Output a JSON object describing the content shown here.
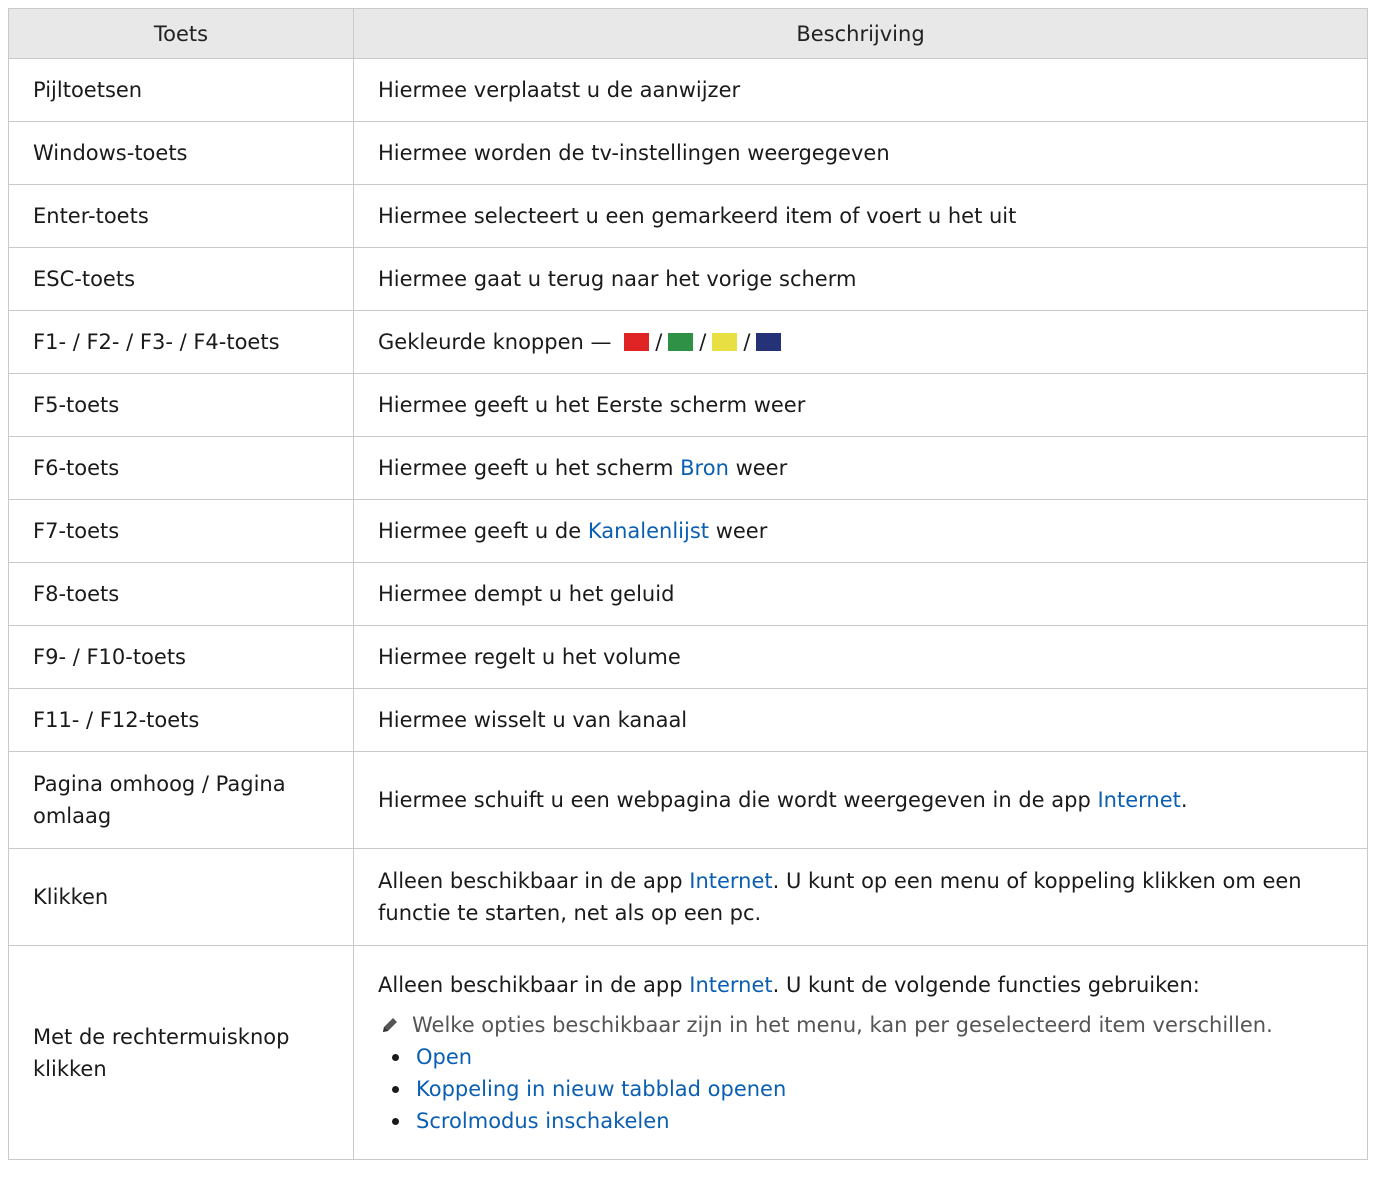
{
  "header": {
    "key": "Toets",
    "description": "Beschrijving"
  },
  "rows": {
    "r0": {
      "key": "Pijltoetsen",
      "desc": "Hiermee verplaatst u de aanwijzer"
    },
    "r1": {
      "key": "Windows-toets",
      "desc": "Hiermee worden de tv-instellingen weergegeven"
    },
    "r2": {
      "key": "Enter-toets",
      "desc": "Hiermee selecteert u een gemarkeerd item of voert u het uit"
    },
    "r3": {
      "key": "ESC-toets",
      "desc": "Hiermee gaat u terug naar het vorige scherm"
    },
    "r4": {
      "key": "F1- / F2- / F3- / F4-toets",
      "desc": "Gekleurde knoppen —",
      "separator": "/",
      "colors": [
        "#e02325",
        "#2e9146",
        "#e8df43",
        "#263278"
      ]
    },
    "r5": {
      "key": "F5-toets",
      "desc": "Hiermee geeft u het Eerste scherm weer"
    },
    "r6": {
      "key": "F6-toets",
      "desc_pre": "Hiermee geeft u het scherm",
      "link": "Bron",
      "desc_post": "weer"
    },
    "r7": {
      "key": "F7-toets",
      "desc_pre": "Hiermee geeft u de",
      "link": "Kanalenlijst",
      "desc_post": "weer"
    },
    "r8": {
      "key": "F8-toets",
      "desc": "Hiermee dempt u het geluid"
    },
    "r9": {
      "key": "F9- / F10-toets",
      "desc": "Hiermee regelt u het volume"
    },
    "r10": {
      "key": "F11- / F12-toets",
      "desc": "Hiermee wisselt u van kanaal"
    },
    "r11": {
      "key": "Pagina omhoog / Pagina omlaag",
      "desc_pre": "Hiermee schuift u een webpagina die wordt weergegeven in de app",
      "link": "Internet",
      "desc_post": "."
    },
    "r12": {
      "key": "Klikken",
      "desc_pre": "Alleen beschikbaar in de app",
      "link": "Internet",
      "desc_post": ". U kunt op een menu of koppeling klikken om een functie te starten, net als op een pc."
    },
    "r13": {
      "key": "Met de rechtermuisknop klikken",
      "desc_pre": "Alleen beschikbaar in de app",
      "link": "Internet",
      "desc_post": ". U kunt de volgende functies gebruiken:",
      "note": "Welke opties beschikbaar zijn in het menu, kan per geselecteerd item verschillen.",
      "options": [
        "Open",
        "Koppeling in nieuw tabblad openen",
        "Scrolmodus inschakelen"
      ]
    }
  },
  "colors": {
    "link": "#0b5fb3",
    "header_bg": "#e8e8e8",
    "border": "#c9c9c9"
  },
  "icons": {
    "note": "pencil-icon",
    "bullet": "bullet-icon"
  }
}
